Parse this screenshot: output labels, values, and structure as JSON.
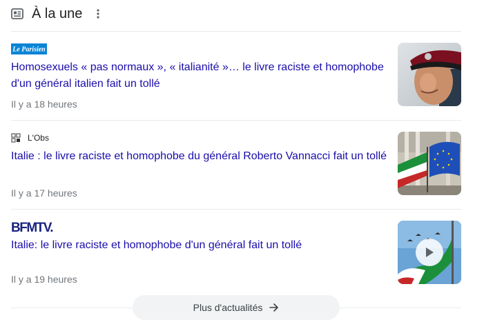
{
  "header": {
    "title": "À la une",
    "icon": "news-icon",
    "more_icon": "more-vert-icon"
  },
  "articles": [
    {
      "source": "Le Parisien",
      "source_logo_color": "#0a84d6",
      "headline": "Homosexuels « pas normaux », « italianité »… le livre raciste et homophobe d'un général italien fait un tollé",
      "time": "Il y a 18 heures",
      "thumbnail": "general-portrait-photo"
    },
    {
      "source": "L'Obs",
      "headline": "Italie : le livre raciste et homophobe du général Roberto Vannacci fait un tollé",
      "time": "Il y a 17 heures",
      "thumbnail": "flags-photo"
    },
    {
      "source": "BFMTV.",
      "source_logo_color": "#1a237e",
      "headline": "Italie: le livre raciste et homophobe d'un général fait un tollé",
      "time": "Il y a 19 heures",
      "thumbnail": "italian-flag-video-thumbnail",
      "play_icon": "play-icon"
    }
  ],
  "more_button": {
    "label": "Plus d'actualités",
    "icon": "arrow-right-icon"
  },
  "colors": {
    "link": "#1a0dab",
    "meta": "#70757a",
    "divider": "#e8eaed",
    "button_bg": "#f1f3f4"
  }
}
